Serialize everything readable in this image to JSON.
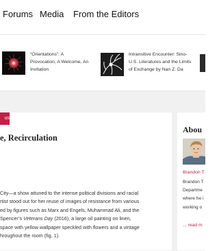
{
  "nav": {
    "items": [
      "Forums",
      "Media",
      "From the Editors"
    ]
  },
  "featured": [
    {
      "icon": "red-seed-pod-image",
      "title_lines": [
        "“Orientations”: A",
        "Provocation, A Welcome, An",
        "Invitation"
      ]
    },
    {
      "icon": "white-flower-image",
      "title_lines": [
        "Intransitive Encounter: Sino-",
        "U.S. Literatures and the Limits",
        "of Exchange by Nan Z. Da"
      ]
    }
  ],
  "article": {
    "category_fragment": "us",
    "title_fragment": "e, Recirculation",
    "body_lines": [
      "City—a show attuned to the intense political divisions and racial",
      "rtist stood out for her reuse of images of resistance from various",
      "ed by figures such as Marx and Engels, Muhammad Ali, and the",
      "Spencer’s ",
      "space with yellow wallpaper speckled with flowers and a vintage",
      "hroughout the room (fig. 1)."
    ],
    "italic_work": "Veterans Day",
    "line4_suffix": " (2016), a large oil painting on linen,"
  },
  "sidebar": {
    "heading_fragment": "Abou",
    "photo_icon": "author-portrait",
    "name_fragment": "Brandon T",
    "bio_lines": [
      "Brandon T",
      "Departme",
      "where he i",
      "working o"
    ],
    "more_fragment": "... read m"
  },
  "colors": {
    "accent": "#c41e44",
    "page_bg": "#f1f1f1",
    "card_bg": "#ffffff"
  }
}
